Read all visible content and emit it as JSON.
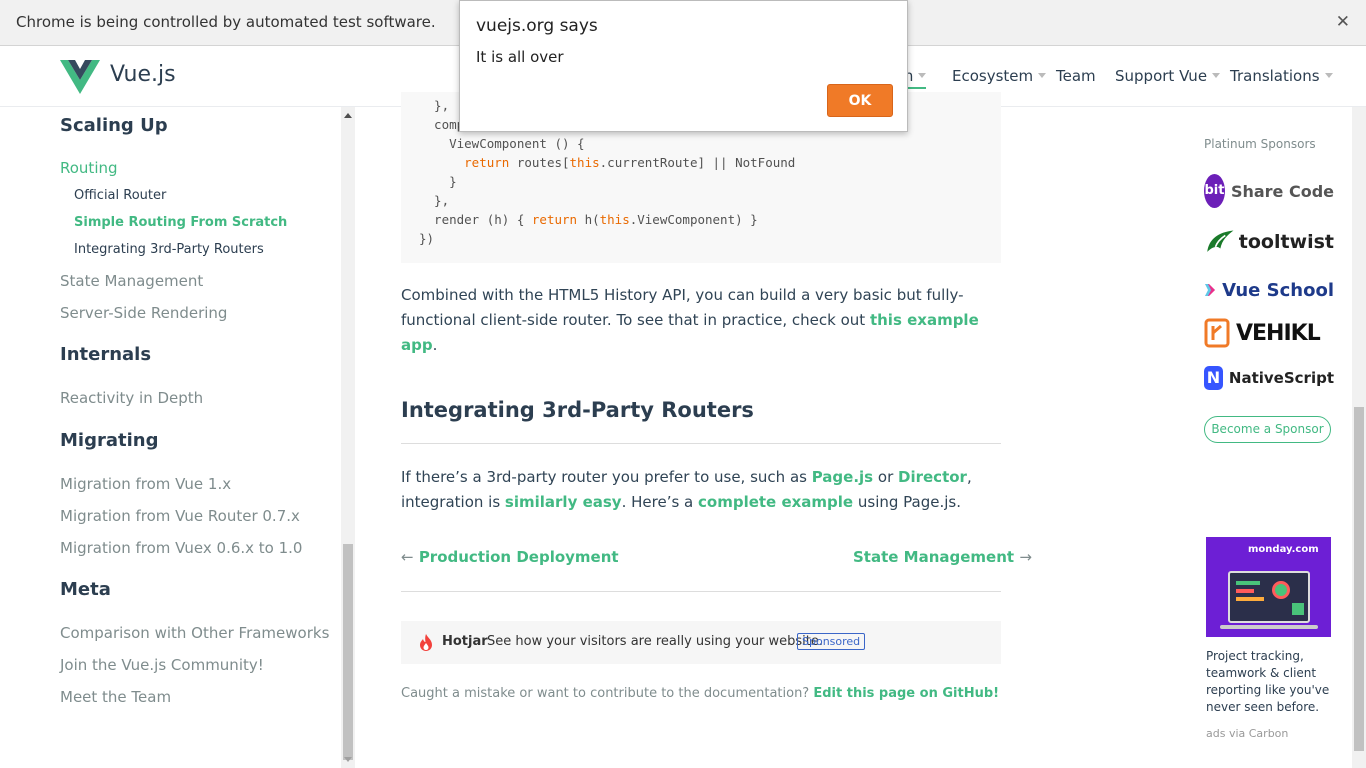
{
  "browser": {
    "infobar_text": "Chrome is being controlled by automated test software.",
    "close_glyph": "✕"
  },
  "header": {
    "brand": "Vue.js",
    "nav": [
      {
        "label": "Learn",
        "visible_fragment": "rn",
        "active": true
      },
      {
        "label": "Ecosystem"
      },
      {
        "label": "Team"
      },
      {
        "label": "Support Vue"
      },
      {
        "label": "Translations"
      }
    ]
  },
  "sidebar": {
    "sections": [
      {
        "title": "Scaling Up"
      },
      {
        "title": "Internals"
      },
      {
        "title": "Migrating"
      },
      {
        "title": "Meta"
      }
    ],
    "items": {
      "routing": "Routing",
      "official_router": "Official Router",
      "simple_routing": "Simple Routing From Scratch",
      "integrating": "Integrating 3rd-Party Routers",
      "state_mgmt": "State Management",
      "ssr": "Server-Side Rendering",
      "reactivity": "Reactivity in Depth",
      "migration_vue1": "Migration from Vue 1.x",
      "migration_router": "Migration from Vue Router 0.7.x",
      "migration_vuex": "Migration from Vuex 0.6.x to 1.0",
      "comparison": "Comparison with Other Frameworks",
      "community": "Join the Vue.js Community!",
      "team": "Meet the Team"
    }
  },
  "content": {
    "code_lines": [
      {
        "t": "  },"
      },
      {
        "t": "  computed: {"
      },
      {
        "t": "    ViewComponent () {"
      },
      {
        "t": "      return routes[this.currentRoute] || NotFound"
      },
      {
        "t": "    }"
      },
      {
        "t": "  },"
      },
      {
        "t": "  render (h) { return h(this.ViewComponent) }"
      },
      {
        "t": "})"
      }
    ],
    "para1_a": "Combined with the HTML5 History API, you can build a very basic but fully-functional client-side router. To see that in practice, check out ",
    "para1_link": "this example app",
    "para1_b": ".",
    "heading": "Integrating 3rd-Party Routers",
    "para2_a": "If there’s a 3rd-party router you prefer to use, such as ",
    "para2_link1": "Page.js",
    "para2_b": " or ",
    "para2_link2": "Director",
    "para2_c": ", integration is ",
    "para2_link3": "similarly easy",
    "para2_d": ". Here’s a ",
    "para2_link4": "complete example",
    "para2_e": " using Page.js.",
    "prev_arrow": "←",
    "prev_label": "Production Deployment",
    "next_label": "State Management",
    "next_arrow": "→",
    "ad_brand": "Hotjar",
    "ad_text": "See how your visitors are really using your website.",
    "ad_badge": "Sponsored",
    "footer_text": "Caught a mistake or want to contribute to the documentation? ",
    "footer_link": "Edit this page on GitHub!"
  },
  "sponsors": {
    "title": "Platinum Sponsors",
    "list": [
      {
        "name": "Share Code",
        "badge": "bit",
        "color": "#6c1fb8"
      },
      {
        "name": "tooltwist",
        "color": "#1a7a2a"
      },
      {
        "name": "Vue School",
        "color": "#1e3a8a"
      },
      {
        "name": "VEHIKL",
        "color": "#111111"
      },
      {
        "name": "NativeScript",
        "badge": "N",
        "color": "#3655ff"
      }
    ],
    "become": "Become a Sponsor"
  },
  "carbon": {
    "brand": "monday.com",
    "text": "Project tracking, teamwork & client reporting like you've never seen before.",
    "via": "ads via Carbon"
  },
  "dialog": {
    "title": "vuejs.org says",
    "message": "It is all over",
    "ok": "OK"
  },
  "colors": {
    "accent": "#42b983",
    "dialog_button": "#f07a27",
    "code_keyword": "#e96900"
  }
}
